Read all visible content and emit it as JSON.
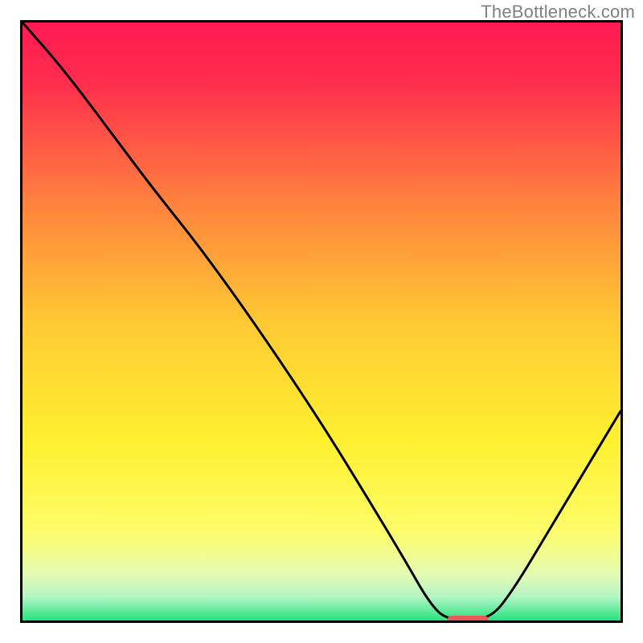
{
  "attribution": {
    "watermark": "TheBottleneck.com"
  },
  "chart_data": {
    "type": "line",
    "title": "",
    "xlabel": "",
    "ylabel": "",
    "xlim": [
      0,
      100
    ],
    "ylim": [
      0,
      100
    ],
    "background_gradient": [
      {
        "offset": 0.0,
        "color": "#ff1a52"
      },
      {
        "offset": 0.1,
        "color": "#ff2d4d"
      },
      {
        "offset": 0.3,
        "color": "#ff813e"
      },
      {
        "offset": 0.5,
        "color": "#ffc934"
      },
      {
        "offset": 0.7,
        "color": "#fff030"
      },
      {
        "offset": 0.85,
        "color": "#fdfc69"
      },
      {
        "offset": 0.92,
        "color": "#e6fbb0"
      },
      {
        "offset": 0.96,
        "color": "#b6f5c6"
      },
      {
        "offset": 1.0,
        "color": "#28e27f"
      }
    ],
    "curve_points": [
      {
        "x": 0,
        "y": 100
      },
      {
        "x": 7,
        "y": 92
      },
      {
        "x": 16,
        "y": 80
      },
      {
        "x": 22,
        "y": 72
      },
      {
        "x": 30,
        "y": 62
      },
      {
        "x": 40,
        "y": 48
      },
      {
        "x": 50,
        "y": 33
      },
      {
        "x": 58,
        "y": 20
      },
      {
        "x": 64,
        "y": 10
      },
      {
        "x": 68,
        "y": 3
      },
      {
        "x": 71,
        "y": 0
      },
      {
        "x": 78,
        "y": 0
      },
      {
        "x": 82,
        "y": 5
      },
      {
        "x": 88,
        "y": 15
      },
      {
        "x": 94,
        "y": 25
      },
      {
        "x": 100,
        "y": 35
      }
    ],
    "marker": {
      "x_start": 71,
      "x_end": 78,
      "y": 0,
      "color": "#e85a5a"
    }
  }
}
